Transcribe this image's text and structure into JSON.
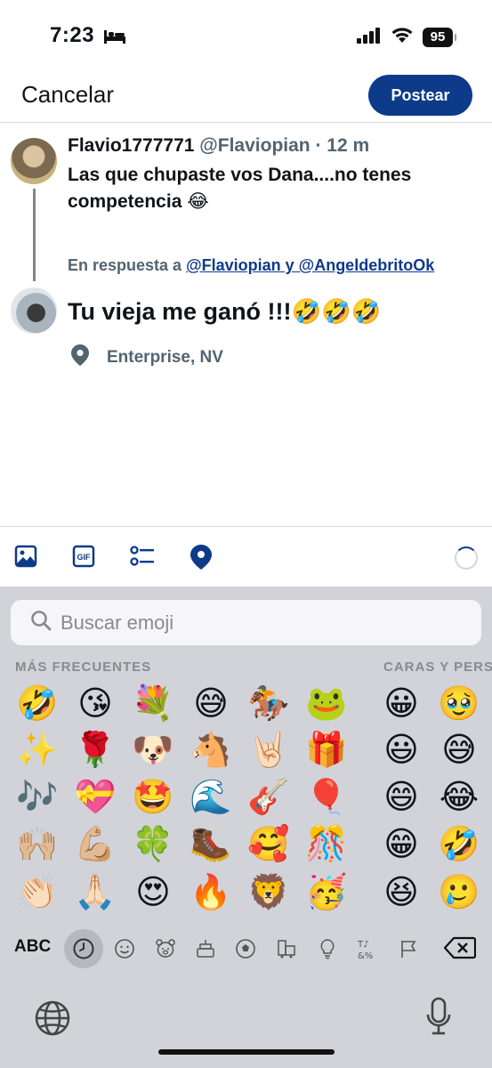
{
  "status": {
    "time": "7:23",
    "battery": "95"
  },
  "header": {
    "cancel": "Cancelar",
    "post": "Postear"
  },
  "reply": {
    "name": "Flavio1777771",
    "handle": "@Flaviopian",
    "dot": " · ",
    "age": "12 m",
    "text": "Las que chupaste vos Dana....no tenes competencia 😂",
    "replying_prefix": "En respuesta a ",
    "replying_mentions": "@Flaviopian y @AngeldebritoOk"
  },
  "compose": {
    "text": "Tu vieja me ganó !!!🤣🤣🤣",
    "location": "Enterprise, NV"
  },
  "keyboard": {
    "search_placeholder": "Buscar emoji",
    "section_frequent": "MÁS FRECUENTES",
    "section_faces": "CARAS Y PERS",
    "abc": "ABC",
    "frequent": [
      [
        "🤣",
        "😘",
        "💐",
        "😅",
        "🏇",
        "🐸"
      ],
      [
        "✨",
        "🌹",
        "🐶",
        "🐴",
        "🤘🏻",
        "🎁"
      ],
      [
        "🎶",
        "💝",
        "🤩",
        "🌊",
        "🎸",
        "🎈"
      ],
      [
        "🙌🏼",
        "💪🏼",
        "🍀",
        "🥾",
        "🥰",
        "🎊"
      ],
      [
        "👏🏻",
        "🙏🏻",
        "😍",
        "🔥",
        "🦁",
        "🥳"
      ]
    ],
    "faces": [
      [
        "😀",
        "🥹"
      ],
      [
        "😃",
        "😅"
      ],
      [
        "😄",
        "😂"
      ],
      [
        "😁",
        "🤣"
      ],
      [
        "😆",
        "🥲"
      ]
    ]
  }
}
